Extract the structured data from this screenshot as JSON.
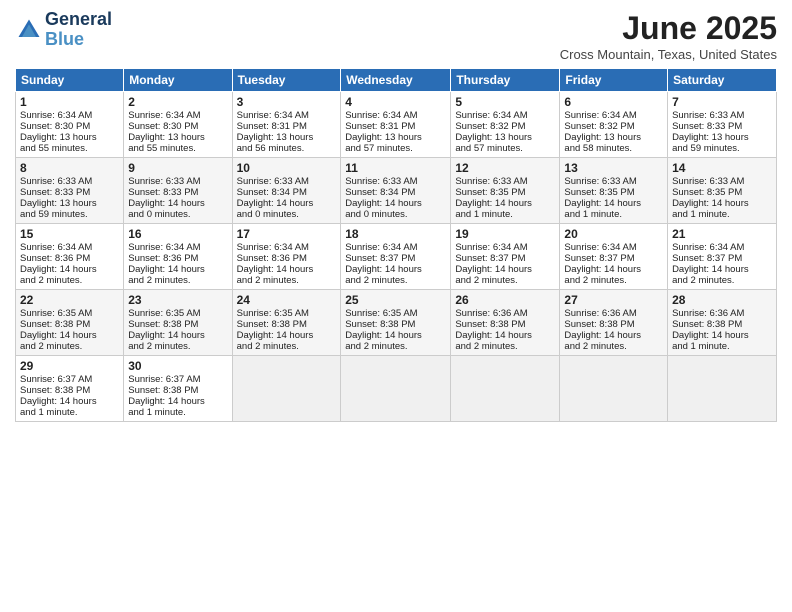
{
  "header": {
    "logo_line1": "General",
    "logo_line2": "Blue",
    "month": "June 2025",
    "location": "Cross Mountain, Texas, United States"
  },
  "weekdays": [
    "Sunday",
    "Monday",
    "Tuesday",
    "Wednesday",
    "Thursday",
    "Friday",
    "Saturday"
  ],
  "weeks": [
    [
      {
        "day": 1,
        "lines": [
          "Sunrise: 6:34 AM",
          "Sunset: 8:30 PM",
          "Daylight: 13 hours",
          "and 55 minutes."
        ]
      },
      {
        "day": 2,
        "lines": [
          "Sunrise: 6:34 AM",
          "Sunset: 8:30 PM",
          "Daylight: 13 hours",
          "and 55 minutes."
        ]
      },
      {
        "day": 3,
        "lines": [
          "Sunrise: 6:34 AM",
          "Sunset: 8:31 PM",
          "Daylight: 13 hours",
          "and 56 minutes."
        ]
      },
      {
        "day": 4,
        "lines": [
          "Sunrise: 6:34 AM",
          "Sunset: 8:31 PM",
          "Daylight: 13 hours",
          "and 57 minutes."
        ]
      },
      {
        "day": 5,
        "lines": [
          "Sunrise: 6:34 AM",
          "Sunset: 8:32 PM",
          "Daylight: 13 hours",
          "and 57 minutes."
        ]
      },
      {
        "day": 6,
        "lines": [
          "Sunrise: 6:34 AM",
          "Sunset: 8:32 PM",
          "Daylight: 13 hours",
          "and 58 minutes."
        ]
      },
      {
        "day": 7,
        "lines": [
          "Sunrise: 6:33 AM",
          "Sunset: 8:33 PM",
          "Daylight: 13 hours",
          "and 59 minutes."
        ]
      }
    ],
    [
      {
        "day": 8,
        "lines": [
          "Sunrise: 6:33 AM",
          "Sunset: 8:33 PM",
          "Daylight: 13 hours",
          "and 59 minutes."
        ]
      },
      {
        "day": 9,
        "lines": [
          "Sunrise: 6:33 AM",
          "Sunset: 8:33 PM",
          "Daylight: 14 hours",
          "and 0 minutes."
        ]
      },
      {
        "day": 10,
        "lines": [
          "Sunrise: 6:33 AM",
          "Sunset: 8:34 PM",
          "Daylight: 14 hours",
          "and 0 minutes."
        ]
      },
      {
        "day": 11,
        "lines": [
          "Sunrise: 6:33 AM",
          "Sunset: 8:34 PM",
          "Daylight: 14 hours",
          "and 0 minutes."
        ]
      },
      {
        "day": 12,
        "lines": [
          "Sunrise: 6:33 AM",
          "Sunset: 8:35 PM",
          "Daylight: 14 hours",
          "and 1 minute."
        ]
      },
      {
        "day": 13,
        "lines": [
          "Sunrise: 6:33 AM",
          "Sunset: 8:35 PM",
          "Daylight: 14 hours",
          "and 1 minute."
        ]
      },
      {
        "day": 14,
        "lines": [
          "Sunrise: 6:33 AM",
          "Sunset: 8:35 PM",
          "Daylight: 14 hours",
          "and 1 minute."
        ]
      }
    ],
    [
      {
        "day": 15,
        "lines": [
          "Sunrise: 6:34 AM",
          "Sunset: 8:36 PM",
          "Daylight: 14 hours",
          "and 2 minutes."
        ]
      },
      {
        "day": 16,
        "lines": [
          "Sunrise: 6:34 AM",
          "Sunset: 8:36 PM",
          "Daylight: 14 hours",
          "and 2 minutes."
        ]
      },
      {
        "day": 17,
        "lines": [
          "Sunrise: 6:34 AM",
          "Sunset: 8:36 PM",
          "Daylight: 14 hours",
          "and 2 minutes."
        ]
      },
      {
        "day": 18,
        "lines": [
          "Sunrise: 6:34 AM",
          "Sunset: 8:37 PM",
          "Daylight: 14 hours",
          "and 2 minutes."
        ]
      },
      {
        "day": 19,
        "lines": [
          "Sunrise: 6:34 AM",
          "Sunset: 8:37 PM",
          "Daylight: 14 hours",
          "and 2 minutes."
        ]
      },
      {
        "day": 20,
        "lines": [
          "Sunrise: 6:34 AM",
          "Sunset: 8:37 PM",
          "Daylight: 14 hours",
          "and 2 minutes."
        ]
      },
      {
        "day": 21,
        "lines": [
          "Sunrise: 6:34 AM",
          "Sunset: 8:37 PM",
          "Daylight: 14 hours",
          "and 2 minutes."
        ]
      }
    ],
    [
      {
        "day": 22,
        "lines": [
          "Sunrise: 6:35 AM",
          "Sunset: 8:38 PM",
          "Daylight: 14 hours",
          "and 2 minutes."
        ]
      },
      {
        "day": 23,
        "lines": [
          "Sunrise: 6:35 AM",
          "Sunset: 8:38 PM",
          "Daylight: 14 hours",
          "and 2 minutes."
        ]
      },
      {
        "day": 24,
        "lines": [
          "Sunrise: 6:35 AM",
          "Sunset: 8:38 PM",
          "Daylight: 14 hours",
          "and 2 minutes."
        ]
      },
      {
        "day": 25,
        "lines": [
          "Sunrise: 6:35 AM",
          "Sunset: 8:38 PM",
          "Daylight: 14 hours",
          "and 2 minutes."
        ]
      },
      {
        "day": 26,
        "lines": [
          "Sunrise: 6:36 AM",
          "Sunset: 8:38 PM",
          "Daylight: 14 hours",
          "and 2 minutes."
        ]
      },
      {
        "day": 27,
        "lines": [
          "Sunrise: 6:36 AM",
          "Sunset: 8:38 PM",
          "Daylight: 14 hours",
          "and 2 minutes."
        ]
      },
      {
        "day": 28,
        "lines": [
          "Sunrise: 6:36 AM",
          "Sunset: 8:38 PM",
          "Daylight: 14 hours",
          "and 1 minute."
        ]
      }
    ],
    [
      {
        "day": 29,
        "lines": [
          "Sunrise: 6:37 AM",
          "Sunset: 8:38 PM",
          "Daylight: 14 hours",
          "and 1 minute."
        ]
      },
      {
        "day": 30,
        "lines": [
          "Sunrise: 6:37 AM",
          "Sunset: 8:38 PM",
          "Daylight: 14 hours",
          "and 1 minute."
        ]
      },
      null,
      null,
      null,
      null,
      null
    ]
  ]
}
